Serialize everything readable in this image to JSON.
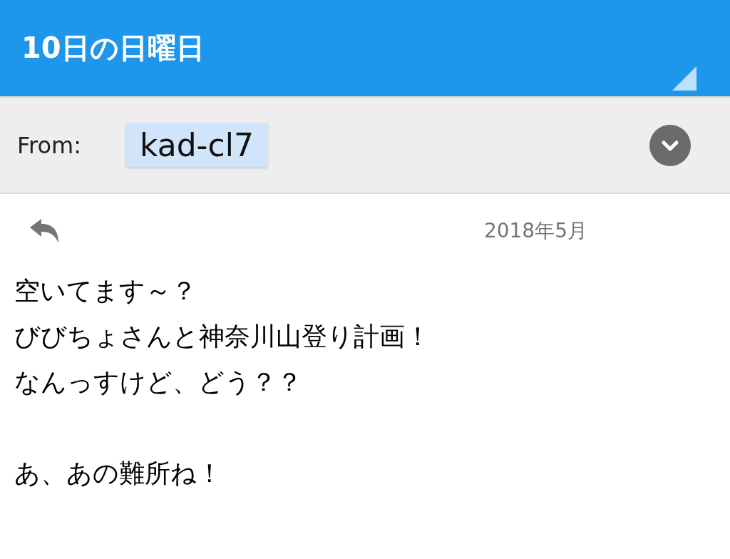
{
  "header": {
    "title": "10日の日曜日"
  },
  "from": {
    "label": "From:",
    "sender": "kad-cl7"
  },
  "message": {
    "date": "2018年5月",
    "paragraphs": [
      [
        "空いてます～？",
        "びびちょさんと神奈川山登り計画！",
        "なんっすけど、どう？？"
      ],
      [
        "あ、あの難所ね！"
      ]
    ]
  }
}
